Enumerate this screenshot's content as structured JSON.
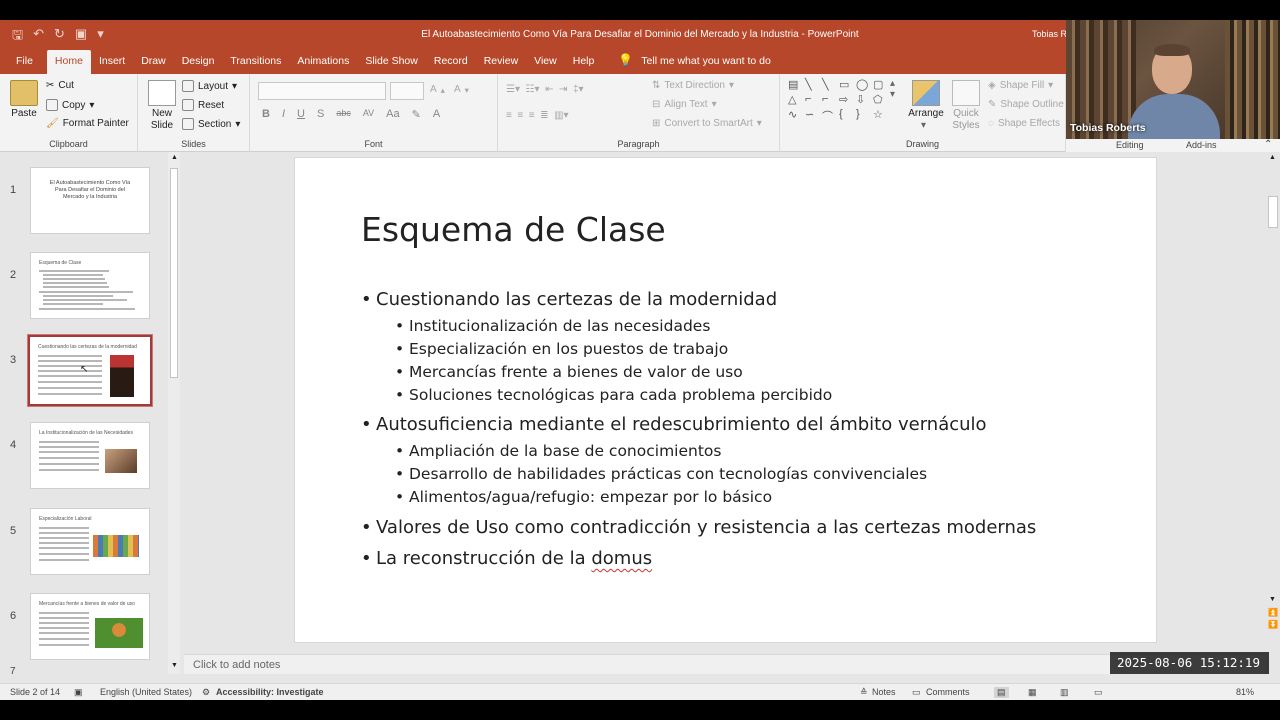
{
  "titlebar": {
    "title": "El Autoabastecimiento Como Vía Para Desafiar el Dominio del Mercado y la Industria  -  PowerPoint",
    "user": "Tobias R"
  },
  "menu": {
    "tabs": [
      "File",
      "Home",
      "Insert",
      "Draw",
      "Design",
      "Transitions",
      "Animations",
      "Slide Show",
      "Record",
      "Review",
      "View",
      "Help"
    ],
    "active": "Home",
    "tell_me": "Tell me what you want to do"
  },
  "ribbon": {
    "clipboard": {
      "paste": "Paste",
      "cut": "Cut",
      "copy": "Copy",
      "format_painter": "Format Painter",
      "label": "Clipboard"
    },
    "slides": {
      "new_slide_1": "New",
      "new_slide_2": "Slide",
      "layout": "Layout",
      "reset": "Reset",
      "section": "Section",
      "label": "Slides"
    },
    "font": {
      "label": "Font",
      "buttons": [
        "B",
        "I",
        "U",
        "S",
        "abc",
        "AV",
        "Aa",
        "A"
      ]
    },
    "paragraph": {
      "label": "Paragraph",
      "text_direction": "Text Direction",
      "align_text": "Align Text",
      "convert": "Convert to SmartArt"
    },
    "drawing": {
      "label": "Drawing",
      "arrange": "Arrange",
      "quick_1": "Quick",
      "quick_2": "Styles",
      "shape_fill": "Shape Fill",
      "shape_outline": "Shape Outline",
      "shape_effects": "Shape Effects"
    },
    "editing": {
      "label": "Editing"
    },
    "addins": {
      "label": "Add-ins"
    }
  },
  "webcam": {
    "name": "Tobias Roberts"
  },
  "thumbnails": [
    {
      "num": "1",
      "title": "El Autoabastecimiento Como Vía Para Desafiar el Dominio del Mercado y la Industria"
    },
    {
      "num": "2",
      "title": "Esquema de Clase"
    },
    {
      "num": "3",
      "title": "Cuestionando las certezas de la modernidad"
    },
    {
      "num": "4",
      "title": "La Institucionalización de las Necesidades"
    },
    {
      "num": "5",
      "title": "Especialización Laboral"
    },
    {
      "num": "6",
      "title": "Mercancías frente a bienes de valor de uso"
    }
  ],
  "slide": {
    "title": "Esquema de Clase",
    "b1": "Cuestionando las certezas de la modernidad",
    "b1_1": "Institucionalización de las necesidades",
    "b1_2": "Especialización en los puestos de trabajo",
    "b1_3": "Mercancías frente a bienes de valor de uso",
    "b1_4": "Soluciones tecnológicas para cada problema percibido",
    "b2": "Autosuficiencia mediante el redescubrimiento del ámbito vernáculo",
    "b2_1": "Ampliación de la base de conocimientos",
    "b2_2": "Desarrollo de habilidades prácticas con tecnologías convivenciales",
    "b2_3": "Alimentos/agua/refugio: empezar por lo básico",
    "b3": "Valores de Uso como contradicción y resistencia a las certezas modernas",
    "b4_pre": "La reconstrucción de la ",
    "b4_word": "domus"
  },
  "notes": {
    "placeholder": "Click to add notes"
  },
  "status": {
    "slide": "Slide 2 of 14",
    "language": "English (United States)",
    "accessibility": "Accessibility: Investigate",
    "notes": "Notes",
    "comments": "Comments",
    "zoom": "81%"
  },
  "timestamp": "2025-08-06  15:12:19"
}
